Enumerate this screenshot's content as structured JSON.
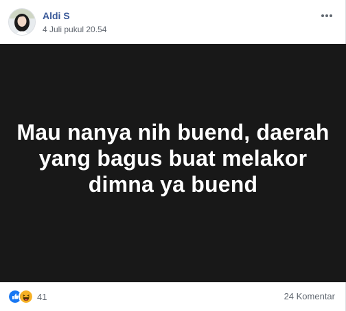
{
  "post": {
    "author": "Aldi S",
    "timestamp": "4 Juli pukul 20.54",
    "image_text": "Mau nanya nih buend, daerah yang bagus buat melakor dimna ya buend",
    "reactions": {
      "icons": [
        "like-icon",
        "haha-icon"
      ],
      "count": "41"
    },
    "comments_label": "24 Komentar"
  },
  "colors": {
    "author_link": "#385898",
    "image_background": "#181818",
    "like_blue": "#1877f2",
    "haha_yellow": "#f7b125",
    "meta_gray": "#616770"
  }
}
